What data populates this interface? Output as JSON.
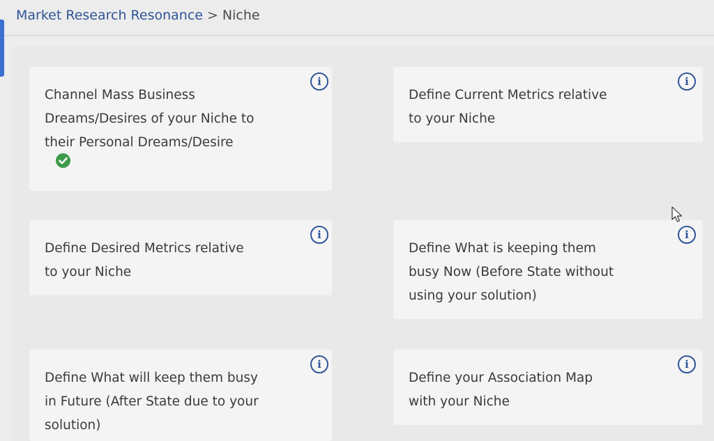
{
  "breadcrumb": {
    "parent": "Market Research Resonance",
    "separator": ">",
    "current": "Niche"
  },
  "cards": [
    {
      "text": "Channel Mass Business\nDreams/Desires of your Niche to\ntheir Personal Dreams/Desire",
      "completed": true
    },
    {
      "text": "Define Current Metrics relative\nto your Niche",
      "completed": false
    },
    {
      "text": "Define Desired Metrics relative\nto your Niche",
      "completed": false
    },
    {
      "text": "Define What is keeping them\nbusy Now (Before State without\nusing your solution)",
      "completed": false
    },
    {
      "text": "Define What will keep them busy\nin Future (After State due to your\nsolution)",
      "completed": false
    },
    {
      "text": "Define your Association Map\nwith your Niche",
      "completed": false
    }
  ],
  "info_glyph": "i",
  "icons": {
    "info": "info-circle-icon",
    "completed": "check-circle-icon",
    "cursor": "mouse-cursor-icon"
  },
  "colors": {
    "link": "#2f5597",
    "check": "#3c9a4a",
    "accent": "#3b6fd0"
  }
}
